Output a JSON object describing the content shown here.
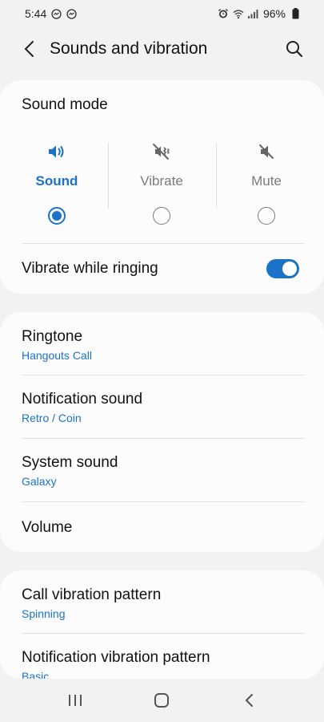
{
  "status_bar": {
    "time": "5:44",
    "battery": "96%",
    "icons_left": [
      "messenger-icon",
      "messenger-icon"
    ],
    "icons_right": [
      "alarm-icon",
      "wifi-icon",
      "signal-icon",
      "battery-icon"
    ]
  },
  "header": {
    "title": "Sounds and vibration"
  },
  "sound_mode": {
    "title": "Sound mode",
    "options": [
      {
        "label": "Sound",
        "icon": "speaker-icon",
        "selected": true
      },
      {
        "label": "Vibrate",
        "icon": "vibrate-muted-icon",
        "selected": false
      },
      {
        "label": "Mute",
        "icon": "mute-icon",
        "selected": false
      }
    ],
    "vibrate_while_ringing": {
      "label": "Vibrate while ringing",
      "on": true
    }
  },
  "sounds_list": [
    {
      "title": "Ringtone",
      "subtitle": "Hangouts Call"
    },
    {
      "title": "Notification sound",
      "subtitle": "Retro / Coin"
    },
    {
      "title": "System sound",
      "subtitle": "Galaxy"
    },
    {
      "title": "Volume",
      "subtitle": ""
    }
  ],
  "vibration_list": [
    {
      "title": "Call vibration pattern",
      "subtitle": "Spinning"
    },
    {
      "title": "Notification vibration pattern",
      "subtitle": "Basic"
    }
  ],
  "colors": {
    "accent": "#1a73c8",
    "background": "#f2f2f2",
    "card": "#fcfcfc"
  }
}
